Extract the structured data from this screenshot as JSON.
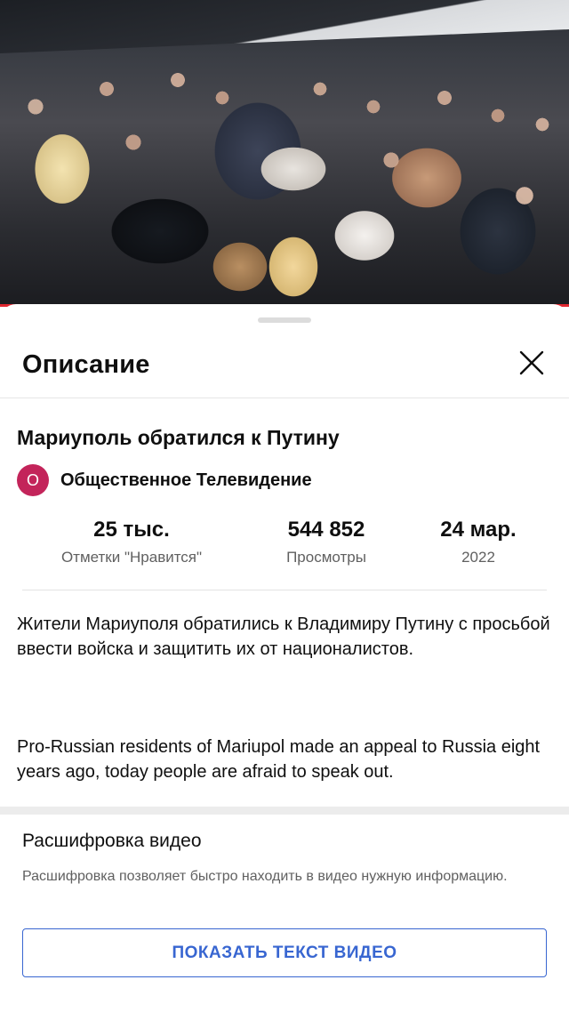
{
  "video": {
    "thumbnail": "crowd-of-people-outdoors",
    "progress_color": "#e0262f"
  },
  "sheet": {
    "title": "Описание",
    "close_icon": "close-icon"
  },
  "details": {
    "title": "Мариуполь обратился к Путину",
    "channel": {
      "avatar_letter": "О",
      "avatar_color": "#c3245a",
      "name": "Общественное Телевидение"
    },
    "stats": [
      {
        "value": "25 тыс.",
        "label": "Отметки \"Нравится\""
      },
      {
        "value": "544 852",
        "label": "Просмотры"
      },
      {
        "value": "24 мар.",
        "label": "2022"
      }
    ],
    "description": [
      "Жители Мариуполя обратились к Владимиру Путину с просьбой ввести войска и защитить их от националистов.",
      "Pro-Russian residents of Mariupol made an appeal to Russia eight years ago, today people are afraid to speak out."
    ]
  },
  "transcript": {
    "title": "Расшифровка видео",
    "description": "Расшифровка позволяет быстро находить в видео нужную информацию.",
    "button_label": "ПОКАЗАТЬ ТЕКСТ ВИДЕО",
    "accent_color": "#3866d1"
  }
}
